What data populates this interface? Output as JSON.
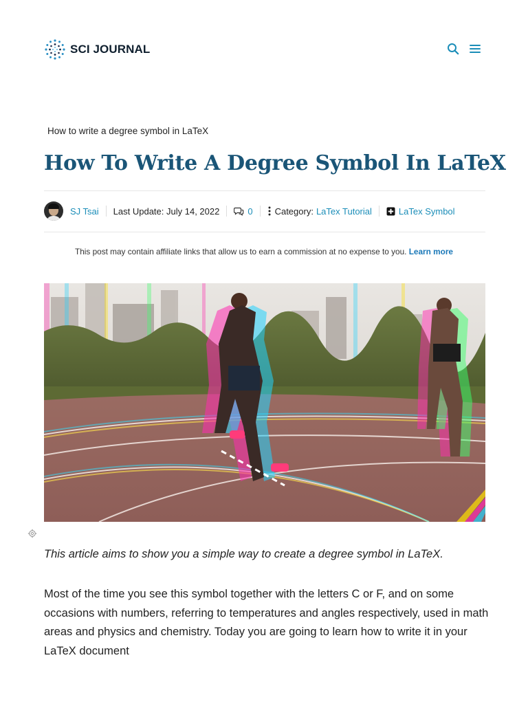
{
  "header": {
    "logo_text": "SCI JOURNAL",
    "icons": [
      "search-icon",
      "menu-icon"
    ],
    "accent": "#1a8db8"
  },
  "breadcrumb": "How to write a degree symbol in LaTeX",
  "title": "How To Write A Degree Symbol In LaTeX",
  "meta": {
    "author": "SJ Tsai",
    "last_update": "Last Update: July 14, 2022",
    "comment_count": "0",
    "category_label": "Category:",
    "category": "LaTex Tutorial",
    "tag": "LaTex Symbol"
  },
  "affiliate": {
    "text": "This post may contain affiliate links that allow us to earn a commission at no expense to you.",
    "learn_more": "Learn more"
  },
  "hero_image": {
    "description_icon": "runners-on-track-photo"
  },
  "article": {
    "intro": "This article aims to show you a simple way to create a degree symbol in LaTeX.",
    "paragraph": "Most of the time you see this symbol together with the letters C or F, and on some occasions with numbers, referring to temperatures and angles respectively, used in math areas and physics and chemistry. Today you are going to learn how to write it in your LaTeX document"
  },
  "colors": {
    "title": "#1a5577",
    "link": "#1a8db8",
    "rule": "#e6e6e6"
  }
}
